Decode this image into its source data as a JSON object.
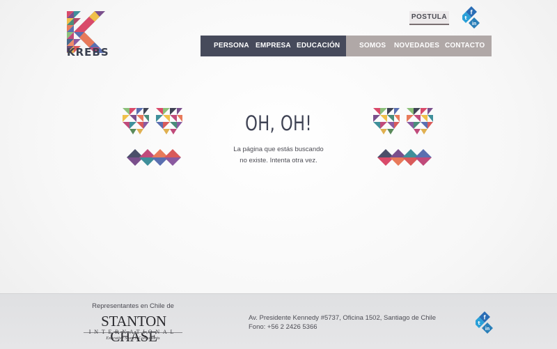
{
  "header": {
    "logo_text": "KREBS",
    "postula_label": "POSTULA",
    "social": [
      "facebook-icon",
      "twitter-icon",
      "linkedin-icon"
    ]
  },
  "nav": {
    "left": [
      {
        "label": "PERSONA"
      },
      {
        "label": "EMPRESA"
      },
      {
        "label": "EDUCACIÓN"
      }
    ],
    "right": [
      {
        "label": "SOMOS"
      },
      {
        "label": "NOVEDADES"
      },
      {
        "label": "CONTACTO"
      }
    ]
  },
  "main": {
    "title": "OH, OH!",
    "message_line1": "La página que estás buscando",
    "message_line2": "no existe. Intenta otra vez."
  },
  "footer": {
    "rep_label": "Representantes en Chile de",
    "brand_name": "STANTON CHASE",
    "brand_sub": "INTERNATIONAL",
    "brand_tagline": "Executive Search Consultants",
    "address": "Av. Presidente Kennedy #5737, Oficina 1502, Santiago de Chile",
    "phone": "Fono: +56 2 2426 5366"
  },
  "colors": {
    "nav_left_bg": "#464a5b",
    "nav_right_bg": "#b0a8a7",
    "title_text": "#3f4354",
    "social_blue": "#2a8cc8",
    "footer_bg": "#e2e2e4"
  }
}
